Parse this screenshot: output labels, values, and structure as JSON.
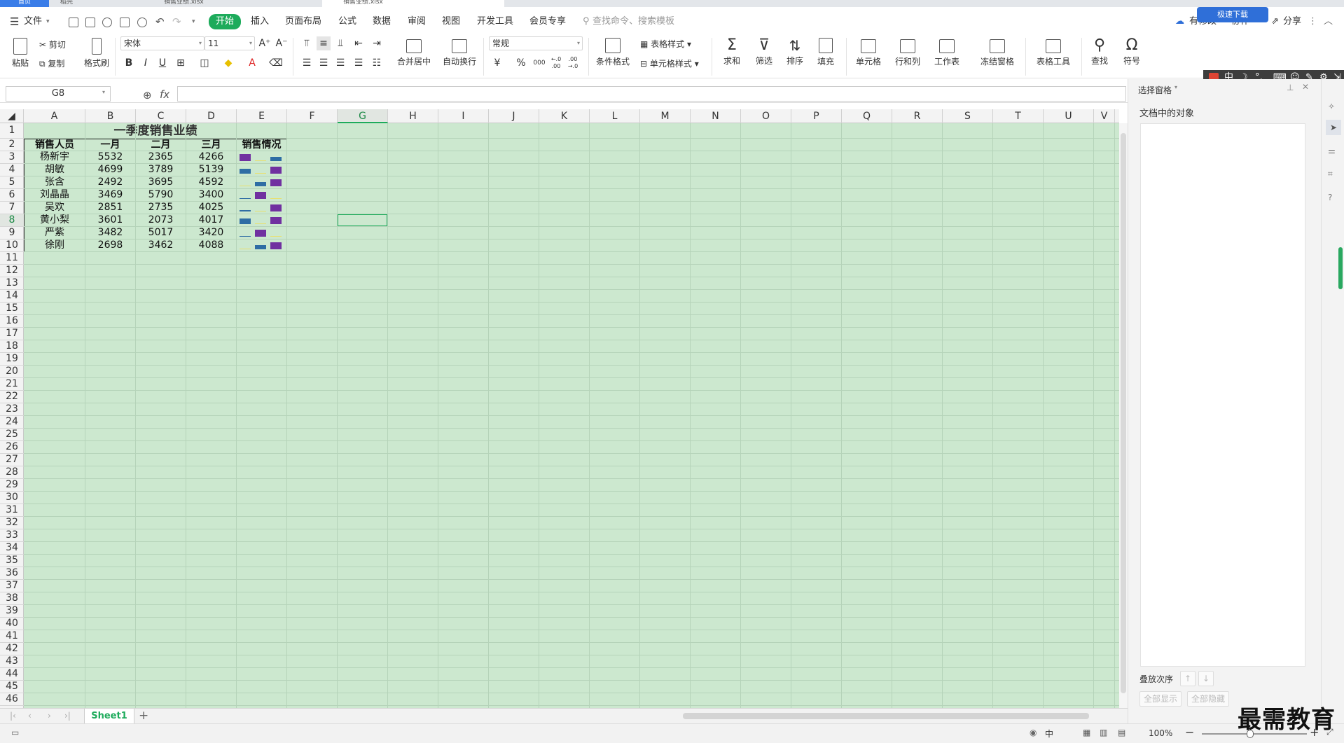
{
  "title_tabs": {
    "home": "首页",
    "doc1": "稻壳",
    "doc2": "销售业绩.xlsx",
    "doc3": "销售业绩.xlsx"
  },
  "menu": {
    "file": "文件",
    "items": [
      "开始",
      "插入",
      "页面布局",
      "公式",
      "数据",
      "审阅",
      "视图",
      "开发工具",
      "会员专享"
    ],
    "search_placeholder": "查找命令、搜索模板",
    "unsaved": "有修改",
    "collab": "协作",
    "share": "分享",
    "cloud_badge": "极速下载"
  },
  "ribbon": {
    "paste": "粘贴",
    "cut": "剪切",
    "copy": "复制",
    "format_painter": "格式刷",
    "font_name": "宋体",
    "font_size": "11",
    "merge_center": "合并居中",
    "wrap_text": "自动换行",
    "number_format": "常规",
    "conditional_format": "条件格式",
    "table_style": "表格样式",
    "cell_style": "单元格样式",
    "sum": "求和",
    "filter": "筛选",
    "sort": "排序",
    "fill": "填充",
    "cell": "单元格",
    "rows_cols": "行和列",
    "worksheet": "工作表",
    "freeze": "冻结窗格",
    "table_tools": "表格工具",
    "find": "查找",
    "symbol": "符号",
    "bold": "B",
    "italic": "I",
    "underline": "U",
    "currency": "¥",
    "percent": "%",
    "thousands": "000",
    "dec_inc": "←.0 .00",
    "dec_dec": ".00 →.0"
  },
  "formula_bar": {
    "cell_ref": "G8",
    "fx": "fx",
    "value": ""
  },
  "columns": [
    "A",
    "B",
    "C",
    "D",
    "E",
    "F",
    "G",
    "H",
    "I",
    "J",
    "K",
    "L",
    "M",
    "N",
    "O",
    "P",
    "Q",
    "R",
    "S",
    "T",
    "U",
    "V"
  ],
  "rows": [
    "1",
    "2",
    "3",
    "4",
    "5",
    "6",
    "7",
    "8",
    "9",
    "10",
    "11",
    "12",
    "13",
    "14",
    "15",
    "16",
    "17",
    "18",
    "19",
    "20",
    "21",
    "22",
    "23",
    "24",
    "25",
    "26",
    "27",
    "28",
    "29",
    "30",
    "31",
    "32",
    "33",
    "34",
    "35",
    "36",
    "37",
    "38",
    "39",
    "40",
    "41",
    "42",
    "43",
    "44",
    "45",
    "46"
  ],
  "selected_cell": "G8",
  "table": {
    "title": "一季度销售业绩",
    "headers": [
      "销售人员",
      "一月",
      "二月",
      "三月",
      "销售情况"
    ],
    "rows": [
      {
        "name": "杨新宇",
        "jan": "5532",
        "feb": "2365",
        "mar": "4266"
      },
      {
        "name": "胡敏",
        "jan": "4699",
        "feb": "3789",
        "mar": "5139"
      },
      {
        "name": "张含",
        "jan": "2492",
        "feb": "3695",
        "mar": "4592"
      },
      {
        "name": "刘晶晶",
        "jan": "3469",
        "feb": "5790",
        "mar": "3400"
      },
      {
        "name": "吴欢",
        "jan": "2851",
        "feb": "2735",
        "mar": "4025"
      },
      {
        "name": "黄小梨",
        "jan": "3601",
        "feb": "2073",
        "mar": "4017"
      },
      {
        "name": "严紫",
        "jan": "3482",
        "feb": "5017",
        "mar": "3420"
      },
      {
        "name": "徐刚",
        "jan": "2698",
        "feb": "3462",
        "mar": "4088"
      }
    ],
    "sparkline_colors": {
      "max": "#7030a0",
      "mid": "#2e6da4",
      "min": "#e8e070"
    }
  },
  "sheet_tabs": [
    "Sheet1"
  ],
  "right_panel": {
    "title": "选择窗格",
    "objects_label": "文档中的对象",
    "order_label": "叠放次序",
    "show_all": "全部显示",
    "hide_all": "全部隐藏"
  },
  "status": {
    "zoom": "100%",
    "lang": "中"
  },
  "ime": {
    "mode": "中"
  },
  "watermark": "最需教育"
}
